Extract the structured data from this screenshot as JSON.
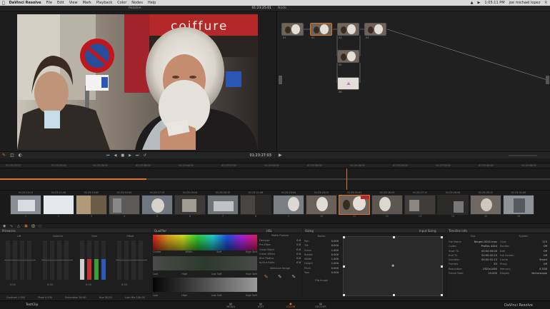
{
  "menubar": {
    "apple": "",
    "items": [
      "DaVinci Resolve",
      "File",
      "Edit",
      "View",
      "Mark",
      "Playback",
      "Color",
      "Nodes",
      "Help"
    ],
    "clock": "1:05:11 PM",
    "user": "joe michael lopez"
  },
  "viewer": {
    "title": "Resolve",
    "timecode_top": "01:23:25:01",
    "timecode_bottom": "01:23:27:03"
  },
  "nodes": {
    "title": "Node",
    "labels": [
      "01",
      "02",
      "03",
      "04",
      "05",
      "06"
    ]
  },
  "timeline": {
    "ruler": [
      "01:23:13:13",
      "01:23:20:00",
      "01:23:28:00",
      "01:23:36:00",
      "01:23:44:00",
      "01:23:52:00",
      "01:24:00:00",
      "01:24:08:00",
      "01:24:16:00",
      "01:24:24:00",
      "01:24:32:00",
      "01:24:40:00",
      "01:24:48:00"
    ]
  },
  "clips": [
    {
      "tc": "01:23:10:11",
      "n": "1"
    },
    {
      "tc": "01:23:11:06",
      "n": "2"
    },
    {
      "tc": "01:23:13:00",
      "n": "3"
    },
    {
      "tc": "01:23:15:02",
      "n": "4"
    },
    {
      "tc": "01:23:17:10",
      "n": "5"
    },
    {
      "tc": "01:23:19:04",
      "n": "6"
    },
    {
      "tc": "01:23:20:15",
      "n": "7"
    },
    {
      "tc": "01:23:21:08",
      "n": "8"
    },
    {
      "tc": "01:23:23:04",
      "n": "9"
    },
    {
      "tc": "01:23:24:12",
      "n": "10"
    },
    {
      "tc": "01:23:25:01",
      "n": "11"
    },
    {
      "tc": "01:23:26:03",
      "n": "12"
    },
    {
      "tc": "01:23:27:11",
      "n": "13"
    },
    {
      "tc": "01:23:28:06",
      "n": "14"
    },
    {
      "tc": "01:23:29:12",
      "n": "15"
    },
    {
      "tc": "01:23:31:00",
      "n": "16"
    }
  ],
  "primaries": {
    "title": "Primaries",
    "wheels": [
      "Lift",
      "Gamma",
      "Gain",
      "Offset"
    ],
    "footer": [
      "Contrast 1.000",
      "Pivot 0.435",
      "Saturation 50.00",
      "Hue 50.00",
      "Lum Mix 100.00"
    ],
    "values": [
      "0.00",
      "0.00",
      "0.00",
      "0.00"
    ]
  },
  "qualifier": {
    "title": "Qualifier",
    "hsl": "HSL",
    "rows": [
      {
        "k": "Center",
        "v": "0.0"
      },
      {
        "k": "Width",
        "v": "0.0"
      },
      {
        "k": "Soft",
        "v": "0.0"
      },
      {
        "k": "Low Soft",
        "v": "0.0"
      },
      {
        "k": "High Soft",
        "v": "0.0"
      }
    ],
    "labels1": [
      "Center",
      "Width",
      "Soft",
      "High Soft"
    ],
    "labels2": [
      "Low",
      "High",
      "Low Soft",
      "High Soft"
    ],
    "section2": "Selection Range",
    "section3": "Matte Finesse",
    "matte": [
      {
        "k": "Denoise",
        "v": "0.0"
      },
      {
        "k": "Pre-Filter",
        "v": "0.0"
      },
      {
        "k": "Clean Black",
        "v": "0.0"
      },
      {
        "k": "Clean White",
        "v": "0.0"
      },
      {
        "k": "Blur Radius",
        "v": "0.0"
      },
      {
        "k": "In/Out Ratio",
        "v": "0.0"
      }
    ]
  },
  "sizing": {
    "title": "Sizing",
    "mode": "Input Sizing",
    "subtitle": "Nodes",
    "rows": [
      {
        "k": "Pan",
        "v": "0.000"
      },
      {
        "k": "Tilt",
        "v": "0.000"
      },
      {
        "k": "Zoom",
        "v": "1.000"
      },
      {
        "k": "Rotate",
        "v": "0.000"
      },
      {
        "k": "Width",
        "v": "1.000"
      },
      {
        "k": "Height",
        "v": "1.000"
      },
      {
        "k": "Pitch",
        "v": "0.000"
      },
      {
        "k": "Yaw",
        "v": "0.000"
      }
    ],
    "flip": "Flip Image"
  },
  "timeline_info": {
    "title": "Timeline Info",
    "left_hdr": "Clip",
    "right_hdr": "System",
    "rows": [
      {
        "k": "File Name",
        "v": "Bergen-0002.mov"
      },
      {
        "k": "Codec",
        "v": "ProRes 4444"
      },
      {
        "k": "Start TC",
        "v": "00:00:00:00"
      },
      {
        "k": "End TC",
        "v": "00:00:02:15"
      },
      {
        "k": "Duration",
        "v": "00:00:02:15"
      },
      {
        "k": "Frames",
        "v": "63"
      },
      {
        "k": "Resolution",
        "v": "1920x1080"
      },
      {
        "k": "Frame Rate",
        "v": "24.000"
      }
    ],
    "rows2": [
      {
        "k": "Clips",
        "v": "123"
      },
      {
        "k": "Render",
        "v": "Off"
      },
      {
        "k": "Edit",
        "v": "Off"
      },
      {
        "k": "Full Screen",
        "v": "Off"
      },
      {
        "k": "Cache",
        "v": "Smart"
      },
      {
        "k": "Proxy",
        "v": "Off"
      },
      {
        "k": "Memory",
        "v": "4.5GB"
      },
      {
        "k": "Display",
        "v": "Vectorscope"
      }
    ]
  },
  "bottom": {
    "project": "TestClip",
    "tabs": [
      "MEDIA",
      "EDIT",
      "COLOR",
      "DELIVER"
    ],
    "brand": "DaVinci Resolve"
  }
}
